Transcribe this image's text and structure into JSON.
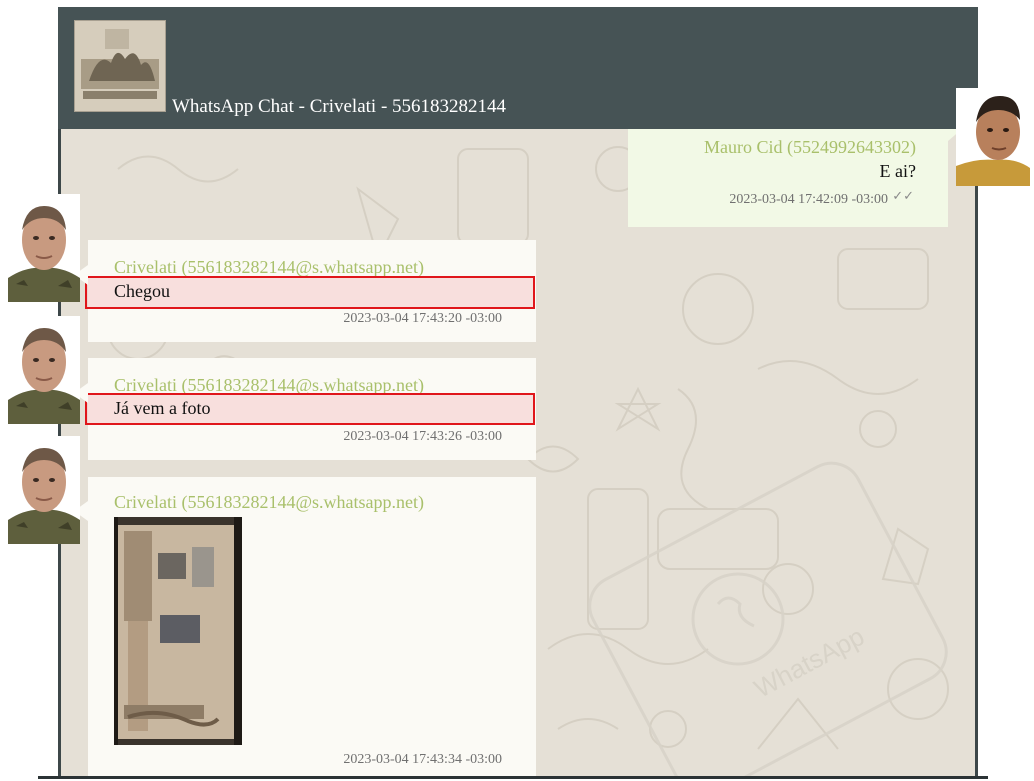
{
  "header": {
    "title": "WhatsApp Chat - Crivelati - 556183282144"
  },
  "messages": [
    {
      "direction": "outgoing",
      "sender": "Mauro Cid (5524992643302)",
      "text": "E ai?",
      "timestamp": "2023-03-04 17:42:09 -03:00",
      "status_icon": "double-check-icon"
    },
    {
      "direction": "incoming",
      "sender": "Crivelati (556183282144@s.whatsapp.net)",
      "text": "Chegou",
      "timestamp": "2023-03-04 17:43:20 -03:00",
      "highlighted": true
    },
    {
      "direction": "incoming",
      "sender": "Crivelati (556183282144@s.whatsapp.net)",
      "text": "Já vem a foto",
      "timestamp": "2023-03-04 17:43:26 -03:00",
      "highlighted": true
    },
    {
      "direction": "incoming",
      "sender": "Crivelati (556183282144@s.whatsapp.net)",
      "media": "photo",
      "timestamp": "2023-03-04 17:43:34 -03:00"
    }
  ],
  "colors": {
    "header_bg": "#465355",
    "chat_bg": "#e5e0d6",
    "sender_name": "#a9c06b",
    "highlight_border": "#e0161b",
    "outgoing_bubble": "#f2f9e6",
    "incoming_bubble": "#fbfaf5"
  }
}
